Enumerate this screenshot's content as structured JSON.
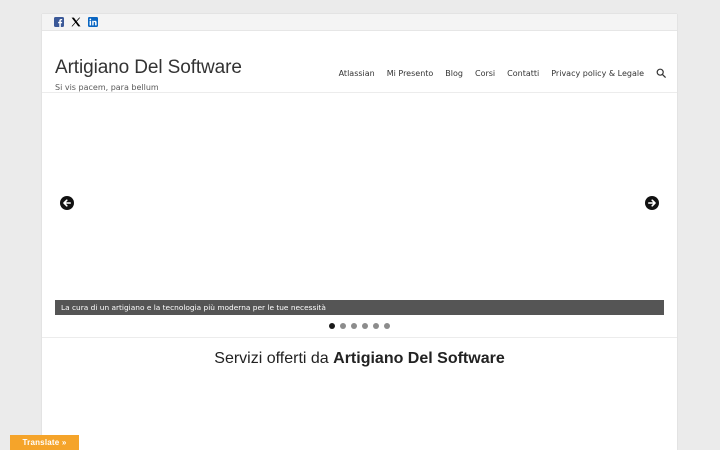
{
  "social": {
    "items": [
      {
        "icon": "facebook-icon",
        "color": "#3b5998"
      },
      {
        "icon": "x-twitter-icon",
        "color": "#000000"
      },
      {
        "icon": "linkedin-icon",
        "color": "#0a66c2"
      }
    ]
  },
  "header": {
    "title": "Artigiano Del Software",
    "tagline": "Si vis pacem, para bellum"
  },
  "nav": {
    "items": [
      "Atlassian",
      "Mi Presento",
      "Blog",
      "Corsi",
      "Contatti",
      "Privacy policy & Legale"
    ],
    "search_icon": "search-icon"
  },
  "slider": {
    "prev_icon": "arrow-left-icon",
    "next_icon": "arrow-right-icon",
    "caption": "La cura di un artigiano e la tecnologia più moderna per le tue necessità",
    "dot_count": 6,
    "active_dot": 1
  },
  "section": {
    "title_prefix": "Servizi offerti da ",
    "title_bold": "Artigiano Del Software"
  },
  "translate_label": "Translate »",
  "colors": {
    "accent_translate": "#f5a42a",
    "caption_bg": "#555555"
  }
}
